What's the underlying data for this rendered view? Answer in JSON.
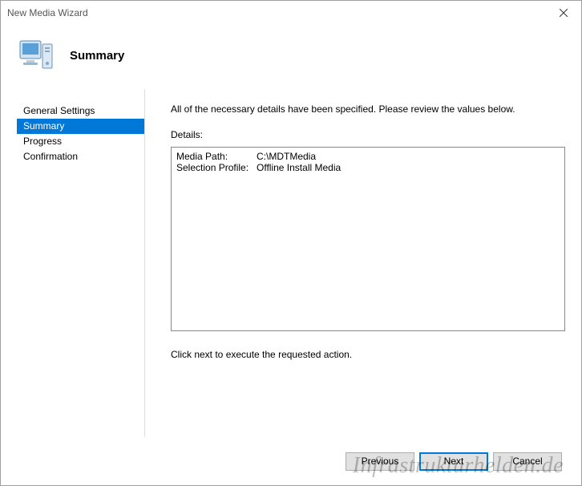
{
  "window": {
    "title": "New Media Wizard"
  },
  "header": {
    "title": "Summary"
  },
  "sidebar": {
    "items": [
      {
        "label": "General Settings",
        "selected": false
      },
      {
        "label": "Summary",
        "selected": true
      },
      {
        "label": "Progress",
        "selected": false
      },
      {
        "label": "Confirmation",
        "selected": false
      }
    ]
  },
  "content": {
    "intro": "All of the necessary details have been specified.  Please review the values below.",
    "details_label": "Details:",
    "details": [
      {
        "key": "Media Path:",
        "value": "C:\\MDTMedia"
      },
      {
        "key": "Selection Profile:",
        "value": "Offline Install Media"
      }
    ],
    "footer_note": "Click next to execute the requested action."
  },
  "buttons": {
    "previous": "Previous",
    "next": "Next",
    "cancel": "Cancel"
  },
  "watermark": "Infrastrukturhelden.de"
}
